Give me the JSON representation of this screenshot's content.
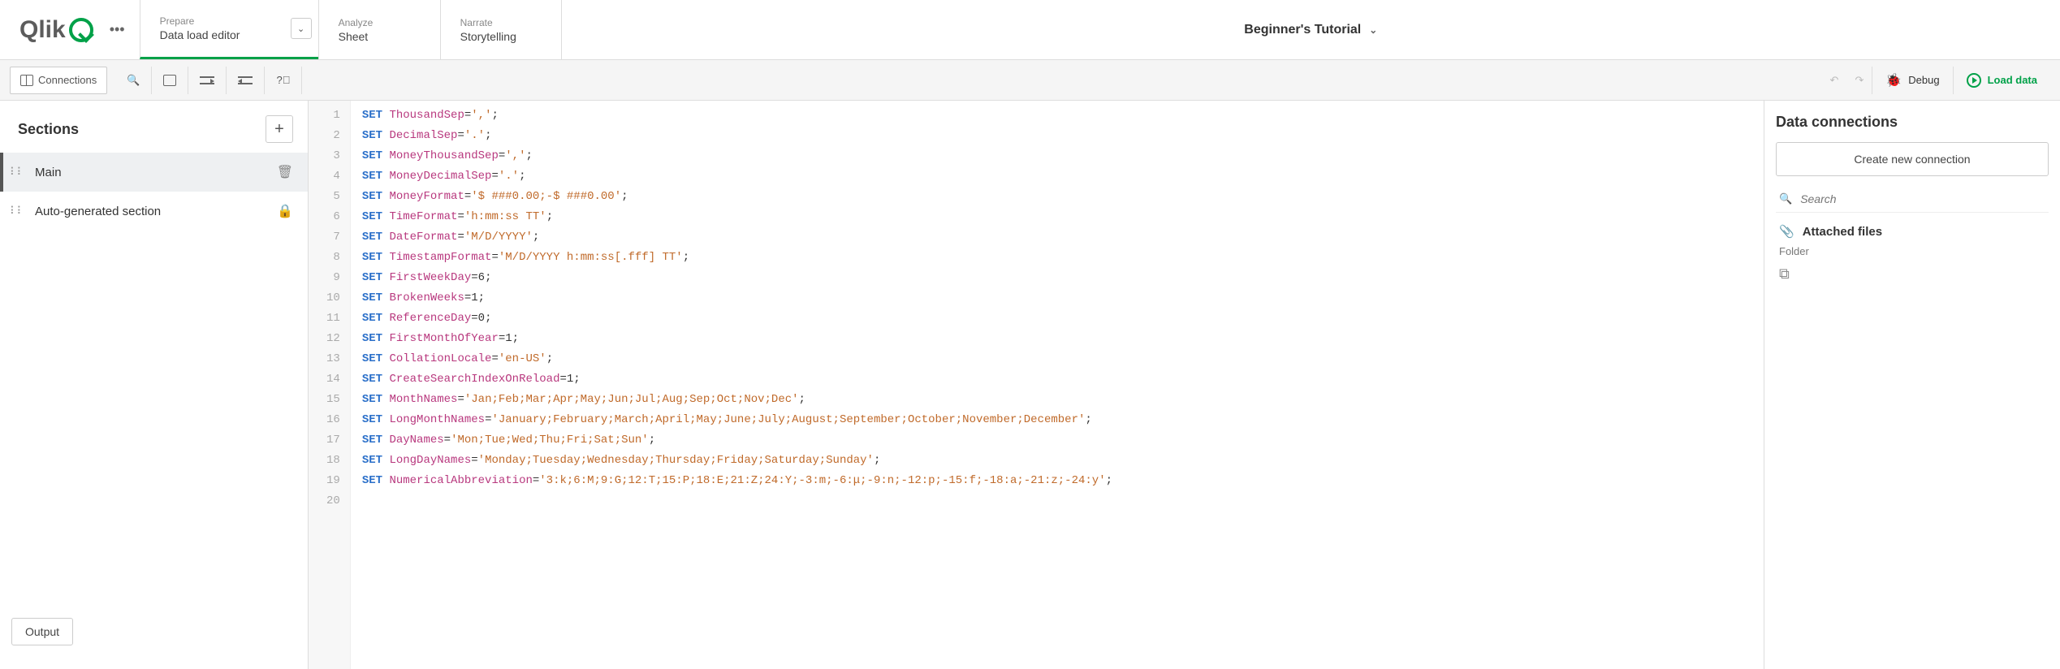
{
  "app": {
    "logo_text": "Qlik",
    "title": "Beginner's Tutorial"
  },
  "nav": {
    "prepare": {
      "small": "Prepare",
      "big": "Data load editor"
    },
    "analyze": {
      "small": "Analyze",
      "big": "Sheet"
    },
    "narrate": {
      "small": "Narrate",
      "big": "Storytelling"
    }
  },
  "toolbar": {
    "connections": "Connections",
    "debug": "Debug",
    "load": "Load data"
  },
  "sections": {
    "title": "Sections",
    "items": [
      {
        "label": "Main"
      },
      {
        "label": "Auto-generated section"
      }
    ]
  },
  "code": {
    "lines": [
      {
        "n": "1",
        "kw": "SET",
        "var": "ThousandSep",
        "rest_str": "','",
        "tail": ";"
      },
      {
        "n": "2",
        "kw": "SET",
        "var": "DecimalSep",
        "rest_str": "'.'",
        "tail": ";"
      },
      {
        "n": "3",
        "kw": "SET",
        "var": "MoneyThousandSep",
        "rest_str": "','",
        "tail": ";"
      },
      {
        "n": "4",
        "kw": "SET",
        "var": "MoneyDecimalSep",
        "rest_str": "'.'",
        "tail": ";"
      },
      {
        "n": "5",
        "kw": "SET",
        "var": "MoneyFormat",
        "rest_str": "'$ ###0.00;-$ ###0.00'",
        "tail": ";"
      },
      {
        "n": "6",
        "kw": "SET",
        "var": "TimeFormat",
        "rest_str": "'h:mm:ss TT'",
        "tail": ";"
      },
      {
        "n": "7",
        "kw": "SET",
        "var": "DateFormat",
        "rest_str": "'M/D/YYYY'",
        "tail": ";"
      },
      {
        "n": "8",
        "kw": "SET",
        "var": "TimestampFormat",
        "rest_str": "'M/D/YYYY h:mm:ss[.fff] TT'",
        "tail": ";"
      },
      {
        "n": "9",
        "kw": "SET",
        "var": "FirstWeekDay",
        "rest_num": "6",
        "tail": ";"
      },
      {
        "n": "10",
        "kw": "SET",
        "var": "BrokenWeeks",
        "rest_num": "1",
        "tail": ";"
      },
      {
        "n": "11",
        "kw": "SET",
        "var": "ReferenceDay",
        "rest_num": "0",
        "tail": ";"
      },
      {
        "n": "12",
        "kw": "SET",
        "var": "FirstMonthOfYear",
        "rest_num": "1",
        "tail": ";"
      },
      {
        "n": "13",
        "kw": "SET",
        "var": "CollationLocale",
        "rest_str": "'en-US'",
        "tail": ";"
      },
      {
        "n": "14",
        "kw": "SET",
        "var": "CreateSearchIndexOnReload",
        "rest_num": "1",
        "tail": ";"
      },
      {
        "n": "15",
        "kw": "SET",
        "var": "MonthNames",
        "rest_str": "'Jan;Feb;Mar;Apr;May;Jun;Jul;Aug;Sep;Oct;Nov;Dec'",
        "tail": ";"
      },
      {
        "n": "16",
        "kw": "SET",
        "var": "LongMonthNames",
        "rest_str": "'January;February;March;April;May;June;July;August;September;October;November;December'",
        "tail": ";"
      },
      {
        "n": "17",
        "kw": "SET",
        "var": "DayNames",
        "rest_str": "'Mon;Tue;Wed;Thu;Fri;Sat;Sun'",
        "tail": ";"
      },
      {
        "n": "18",
        "kw": "SET",
        "var": "LongDayNames",
        "rest_str": "'Monday;Tuesday;Wednesday;Thursday;Friday;Saturday;Sunday'",
        "tail": ";"
      },
      {
        "n": "19",
        "kw": "SET",
        "var": "NumericalAbbreviation",
        "rest_str": "'3:k;6:M;9:G;12:T;15:P;18:E;21:Z;24:Y;-3:m;-6:μ;-9:n;-12:p;-15:f;-18:a;-21:z;-24:y'",
        "tail": ";"
      },
      {
        "n": "20"
      }
    ]
  },
  "right": {
    "title": "Data connections",
    "create_btn": "Create new connection",
    "search_placeholder": "Search",
    "attached": "Attached files",
    "folder": "Folder"
  },
  "output_btn": "Output"
}
